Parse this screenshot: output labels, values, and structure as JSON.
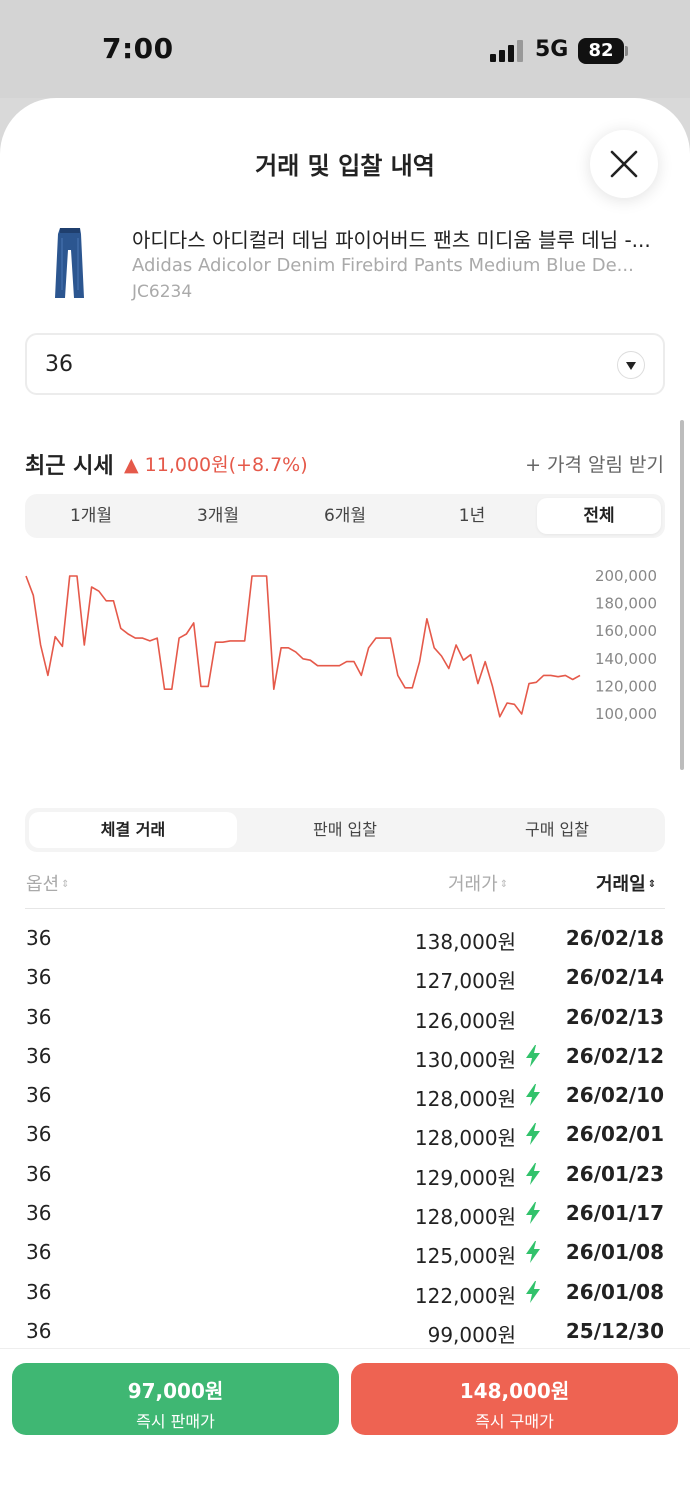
{
  "status_bar": {
    "time": "7:00",
    "network": "5G",
    "battery": "82"
  },
  "sheet": {
    "title": "거래 및 입찰 내역"
  },
  "product": {
    "name_ko": "아디다스 아디컬러 데님 파이어버드 팬츠 미디움 블루 데님 -...",
    "name_en": "Adidas Adicolor Denim Firebird Pants Medium Blue De...",
    "code": "JC6234"
  },
  "size_select": {
    "value": "36"
  },
  "recent_price": {
    "title": "최근 시세",
    "change": "▲ 11,000원(+8.7%)",
    "alert_link": "+ 가격 알림 받기"
  },
  "period_tabs": [
    {
      "label": "1개월"
    },
    {
      "label": "3개월"
    },
    {
      "label": "6개월"
    },
    {
      "label": "1년"
    },
    {
      "label": "전체",
      "active": true
    }
  ],
  "chart_data": {
    "type": "line",
    "y_tick_labels": [
      "200,000",
      "180,000",
      "160,000",
      "140,000",
      "120,000",
      "100,000"
    ],
    "ylim": [
      95000,
      205000
    ],
    "color": "#e5594a",
    "grid": false,
    "series": [
      {
        "values": [
          200000,
          186000,
          150000,
          128000,
          156000,
          149000,
          200000,
          200000,
          150000,
          192000,
          189000,
          182000,
          182000,
          162000,
          158000,
          155000,
          155000,
          153000,
          155000,
          118000,
          118000,
          155000,
          158000,
          166000,
          120000,
          120000,
          152000,
          152000,
          153000,
          153000,
          153000,
          200000,
          200000,
          200000,
          118000,
          148000,
          148000,
          145000,
          140000,
          139000,
          135000,
          135000,
          135000,
          135000,
          138000,
          138000,
          128000,
          148000,
          155000,
          155000,
          155000,
          128000,
          119000,
          119000,
          138000,
          169000,
          148000,
          142000,
          133000,
          150000,
          139000,
          143000,
          122000,
          138000,
          120000,
          98000,
          108000,
          107000,
          100000,
          122000,
          123000,
          128000,
          128000,
          127000,
          128000,
          125000,
          128000
        ]
      }
    ]
  },
  "trade_tabs": [
    {
      "label": "체결 거래",
      "active": true
    },
    {
      "label": "판매 입찰"
    },
    {
      "label": "구매 입찰"
    }
  ],
  "table": {
    "headers": {
      "option": "옵션",
      "price": "거래가",
      "date": "거래일"
    },
    "rows": [
      {
        "size": "36",
        "price": "138,000원",
        "fast": false,
        "date": "26/02/18"
      },
      {
        "size": "36",
        "price": "127,000원",
        "fast": false,
        "date": "26/02/14"
      },
      {
        "size": "36",
        "price": "126,000원",
        "fast": false,
        "date": "26/02/13"
      },
      {
        "size": "36",
        "price": "130,000원",
        "fast": true,
        "date": "26/02/12"
      },
      {
        "size": "36",
        "price": "128,000원",
        "fast": true,
        "date": "26/02/10"
      },
      {
        "size": "36",
        "price": "128,000원",
        "fast": true,
        "date": "26/02/01"
      },
      {
        "size": "36",
        "price": "129,000원",
        "fast": true,
        "date": "26/01/23"
      },
      {
        "size": "36",
        "price": "128,000원",
        "fast": true,
        "date": "26/01/17"
      },
      {
        "size": "36",
        "price": "125,000원",
        "fast": true,
        "date": "26/01/08"
      },
      {
        "size": "36",
        "price": "122,000원",
        "fast": true,
        "date": "26/01/08"
      },
      {
        "size": "36",
        "price": "99,000원",
        "fast": false,
        "date": "25/12/30"
      }
    ]
  },
  "bottom": {
    "sell": {
      "price": "97,000원",
      "label": "즉시 판매가"
    },
    "buy": {
      "price": "148,000원",
      "label": "즉시 구매가"
    }
  },
  "colors": {
    "accent_red": "#ee6352",
    "accent_green": "#3fb773",
    "bolt_green": "#31c26b"
  }
}
